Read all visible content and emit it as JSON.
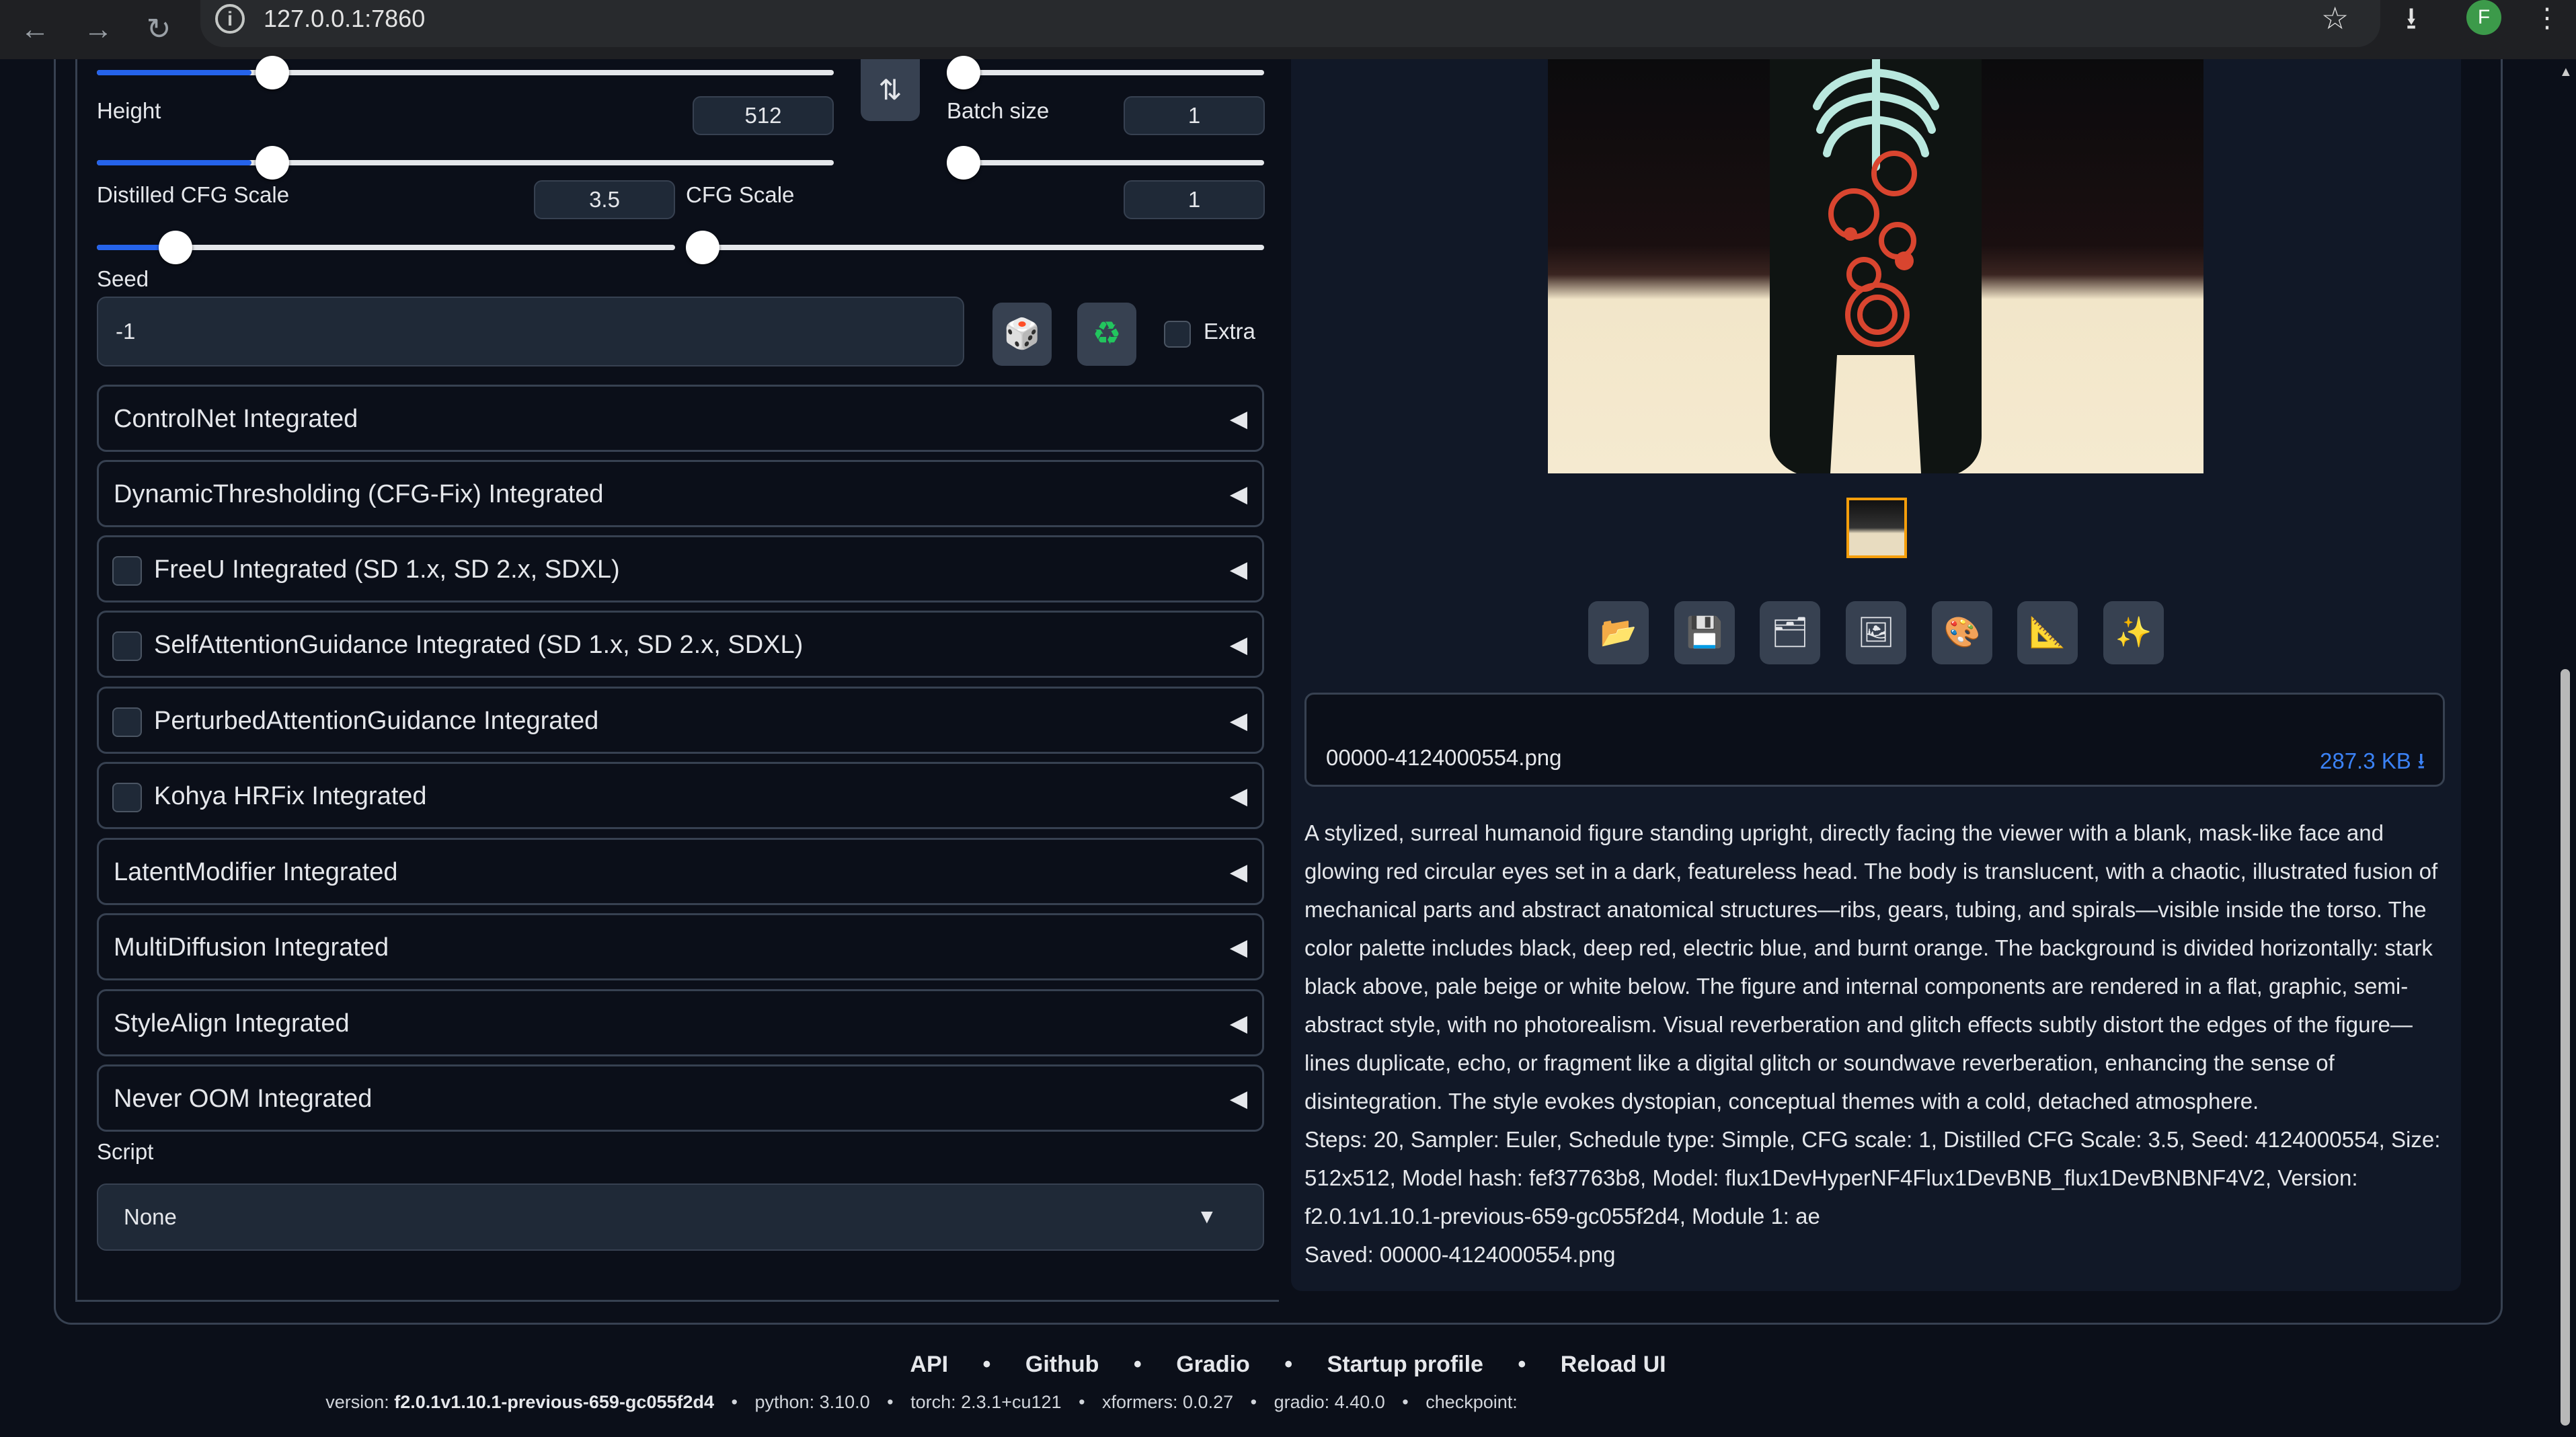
{
  "browser": {
    "url": "127.0.0.1:7860",
    "profile_initial": "F"
  },
  "params": {
    "height_label": "Height",
    "height_value": "512",
    "height_fraction": 0.21,
    "batch_size_label": "Batch size",
    "batch_size_value": "1",
    "batch_size_fraction": 0.0,
    "distilled_cfg_label": "Distilled CFG Scale",
    "distilled_cfg_value": "3.5",
    "distilled_cfg_fraction": 0.14,
    "cfg_label": "CFG Scale",
    "cfg_value": "1",
    "cfg_fraction": 0.0,
    "seed_label": "Seed",
    "seed_value": "-1",
    "extra_label": "Extra"
  },
  "accordions": [
    {
      "label": "ControlNet Integrated",
      "checkbox": false
    },
    {
      "label": "DynamicThresholding (CFG-Fix) Integrated",
      "checkbox": false
    },
    {
      "label": "FreeU Integrated (SD 1.x, SD 2.x, SDXL)",
      "checkbox": true
    },
    {
      "label": "SelfAttentionGuidance Integrated (SD 1.x, SD 2.x, SDXL)",
      "checkbox": true
    },
    {
      "label": "PerturbedAttentionGuidance Integrated",
      "checkbox": true
    },
    {
      "label": "Kohya HRFix Integrated",
      "checkbox": true
    },
    {
      "label": "LatentModifier Integrated",
      "checkbox": false
    },
    {
      "label": "MultiDiffusion Integrated",
      "checkbox": false
    },
    {
      "label": "StyleAlign Integrated",
      "checkbox": false
    },
    {
      "label": "Never OOM Integrated",
      "checkbox": false
    }
  ],
  "script": {
    "label": "Script",
    "selected": "None"
  },
  "output": {
    "file_name": "00000-4124000554.png",
    "file_size": "287.3 KB ⭳",
    "tools": [
      "folder-icon",
      "save-icon",
      "archive-icon",
      "image-icon",
      "palette-icon",
      "ruler-icon",
      "sparkle-icon"
    ],
    "description": "A stylized, surreal humanoid figure standing upright, directly facing the viewer with a blank, mask-like face and glowing red circular eyes set in a dark, featureless head. The body is translucent, with a chaotic, illustrated fusion of mechanical parts and abstract anatomical structures—ribs, gears, tubing, and spirals—visible inside the torso. The color palette includes black, deep red, electric blue, and burnt orange. The background is divided horizontally: stark black above, pale beige or white below. The figure and internal components are rendered in a flat, graphic, semi-abstract style, with no photorealism. Visual reverberation and glitch effects subtly distort the edges of the figure—lines duplicate, echo, or fragment like a digital glitch or soundwave reverberation, enhancing the sense of disintegration. The style evokes dystopian, conceptual themes with a cold, detached atmosphere.",
    "params_line": "Steps: 20, Sampler: Euler, Schedule type: Simple, CFG scale: 1, Distilled CFG Scale: 3.5, Seed: 4124000554, Size: 512x512, Model hash: fef37763b8, Model: flux1DevHyperNF4Flux1DevBNB_flux1DevBNBNF4V2, Version: f2.0.1v1.10.1-previous-659-gc055f2d4, Module 1: ae",
    "saved_line": "Saved: 00000-4124000554.png"
  },
  "footer": {
    "links": [
      "API",
      "Github",
      "Gradio",
      "Startup profile",
      "Reload UI"
    ],
    "version_label": "version:",
    "version_value": "f2.0.1v1.10.1-previous-659-gc055f2d4",
    "python": "python: 3.10.0",
    "torch": "torch: 2.3.1+cu121",
    "xformers": "xformers: 0.0.27",
    "gradio": "gradio: 4.40.0",
    "checkpoint": "checkpoint:"
  },
  "colors": {
    "background": "#0b0f19",
    "accent": "#2563eb",
    "link": "#3b82f6"
  }
}
